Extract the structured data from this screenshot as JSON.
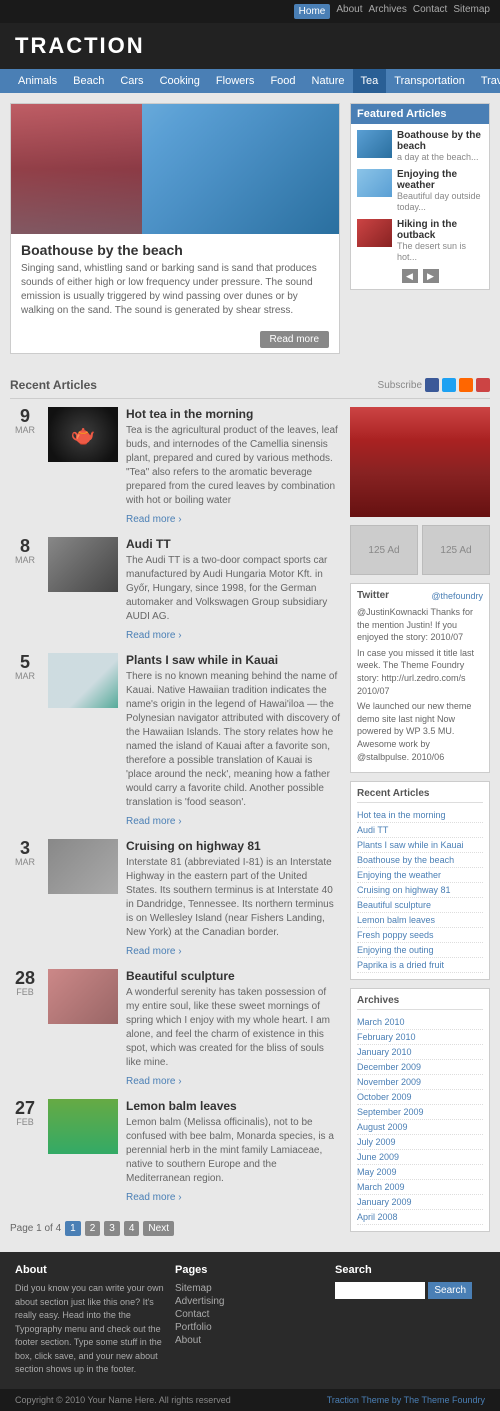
{
  "topnav": {
    "items": [
      "Home",
      "About",
      "Archives",
      "Contact",
      "Sitemap"
    ],
    "active": "Home"
  },
  "header": {
    "logo": "TRACTION"
  },
  "catnav": {
    "items": [
      "Animals",
      "Beach",
      "Cars",
      "Cooking",
      "Flowers",
      "Food",
      "Nature",
      "Tea",
      "Transportation",
      "Travel"
    ],
    "active": "Tea"
  },
  "featured": {
    "title": "Boathouse by the beach",
    "description": "Singing sand, whistling sand or barking sand is sand that produces sounds of either high or low frequency under pressure. The sound emission is usually triggered by wind passing over dunes or by walking on the sand. The sound is generated by shear stress.",
    "readmore": "Read more",
    "articles_title": "Featured Articles",
    "articles": [
      {
        "title": "Boathouse by the beach",
        "subtitle": "a day at the beach..."
      },
      {
        "title": "Enjoying the weather",
        "subtitle": "Beautiful day outside today..."
      },
      {
        "title": "Hiking in the outback",
        "subtitle": "The desert sun is hot..."
      }
    ]
  },
  "recent": {
    "title": "Recent Articles",
    "subscribe": "Subscribe"
  },
  "articles": [
    {
      "day": "9",
      "month": "MAR",
      "title": "Hot tea in the morning",
      "body": "Tea is the agricultural product of the leaves, leaf buds, and internodes of the Camellia sinensis plant, prepared and cured by various methods. \"Tea\" also refers to the aromatic beverage prepared from the cured leaves by combination with hot or boiling water",
      "readmore": "Read more"
    },
    {
      "day": "8",
      "month": "MAR",
      "title": "Audi TT",
      "body": "The Audi TT is a two-door compact sports car manufactured by Audi Hungaria Motor Kft. in Győr, Hungary, since 1998, for the German automaker and Volkswagen Group subsidiary AUDI AG.",
      "readmore": "Read more"
    },
    {
      "day": "5",
      "month": "MAR",
      "title": "Plants I saw while in Kauai",
      "body": "There is no known meaning behind the name of Kauai. Native Hawaiian tradition indicates the name's origin in the legend of Hawai'iloa — the Polynesian navigator attributed with discovery of the Hawaiian Islands. The story relates how he named the island of Kauai after a favorite son, therefore a possible translation of Kauai is 'place around the neck', meaning how a father would carry a favorite child. Another possible translation is 'food season'.",
      "readmore": "Read more"
    },
    {
      "day": "3",
      "month": "MAR",
      "title": "Cruising on highway 81",
      "body": "Interstate 81 (abbreviated I-81) is an Interstate Highway in the eastern part of the United States. Its southern terminus is at Interstate 40 in Dandridge, Tennessee. Its northern terminus is on Wellesley Island (near Fishers Landing, New York) at the Canadian border.",
      "readmore": "Read more"
    },
    {
      "day": "28",
      "month": "FEB",
      "title": "Beautiful sculpture",
      "body": "A wonderful serenity has taken possession of my entire soul, like these sweet mornings of spring which I enjoy with my whole heart. I am alone, and feel the charm of existence in this spot, which was created for the bliss of souls like mine.",
      "readmore": "Read more"
    },
    {
      "day": "27",
      "month": "FEB",
      "title": "Lemon balm leaves",
      "body": "Lemon balm (Melissa officinalis), not to be confused with bee balm, Monarda species, is a perennial herb in the mint family Lamiaceae, native to southern Europe and the Mediterranean region.",
      "readmore": "Read more"
    }
  ],
  "pagination": {
    "label": "Page 1 of 4",
    "pages": [
      "1",
      "2",
      "3",
      "4"
    ],
    "next": "Next",
    "active": "1"
  },
  "twitter": {
    "label": "Twitter",
    "handle": "@thefoundry",
    "tweets": [
      "@JustinKownacki Thanks for the mention Justin! If you enjoyed the story: 2010/07",
      "In case you missed it title last week. The Theme Foundry story: http://url.zedro.com/s 2010/07",
      "We launched our new theme demo site last night Now powered by WP 3.5 MU. Awesome work by @stalbpulse. 2010/06"
    ]
  },
  "sidebar_recent": {
    "title": "Recent Articles",
    "items": [
      "Hot tea in the morning",
      "Audi TT",
      "Plants I saw while in Kauai",
      "Boathouse by the beach",
      "Enjoying the weather",
      "Cruising on highway 81",
      "Beautiful sculpture",
      "Lemon balm leaves",
      "Fresh poppy seeds",
      "Enjoying the outing",
      "Paprika is a dried fruit"
    ]
  },
  "archives": {
    "title": "Archives",
    "items": [
      "March 2010",
      "February 2010",
      "January 2010",
      "December 2009",
      "November 2009",
      "October 2009",
      "September 2009",
      "August 2009",
      "July 2009",
      "June 2009",
      "May 2009",
      "March 2009",
      "January 2009",
      "April 2008"
    ]
  },
  "footer": {
    "about_title": "About",
    "about_text": "Did you know you can write your own about section just like this one? It's really easy. Head into the the Typography menu and check out the footer section. Type some stuff in the box, click save, and your new about section shows up in the footer.",
    "pages_title": "Pages",
    "pages": [
      "Sitemap",
      "Advertising",
      "Contact",
      "Portfolio",
      "About"
    ],
    "search_title": "Search",
    "search_placeholder": "",
    "search_btn": "Search",
    "copyright": "Copyright © 2010 Your Name Here. All rights reserved",
    "theme_credit": "Traction Theme by The Theme Foundry"
  }
}
